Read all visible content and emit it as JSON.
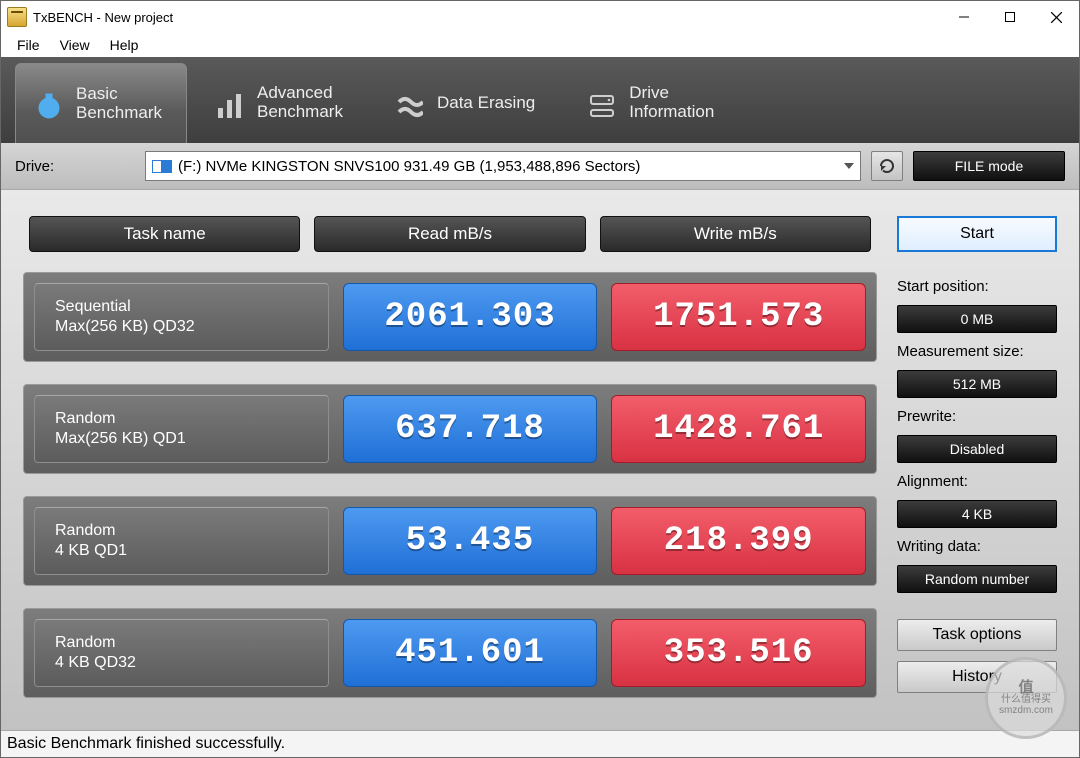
{
  "window": {
    "title": "TxBENCH - New project"
  },
  "menu": {
    "file": "File",
    "view": "View",
    "help": "Help"
  },
  "tabs": {
    "basic": "Basic\nBenchmark",
    "advanced": "Advanced\nBenchmark",
    "erasing": "Data Erasing",
    "driveinfo": "Drive\nInformation"
  },
  "drive": {
    "label": "Drive:",
    "selected": "(F:) NVMe KINGSTON SNVS100  931.49 GB (1,953,488,896 Sectors)",
    "mode_button": "FILE mode"
  },
  "headers": {
    "task": "Task name",
    "read": "Read mB/s",
    "write": "Write mB/s"
  },
  "rows": [
    {
      "name": "Sequential",
      "sub": "Max(256 KB) QD32",
      "read": "2061.303",
      "write": "1751.573"
    },
    {
      "name": "Random",
      "sub": "Max(256 KB) QD1",
      "read": "637.718",
      "write": "1428.761"
    },
    {
      "name": "Random",
      "sub": "4 KB QD1",
      "read": "53.435",
      "write": "218.399"
    },
    {
      "name": "Random",
      "sub": "4 KB QD32",
      "read": "451.601",
      "write": "353.516"
    }
  ],
  "sidebar": {
    "start": "Start",
    "start_pos_label": "Start position:",
    "start_pos": "0 MB",
    "meas_size_label": "Measurement size:",
    "meas_size": "512 MB",
    "prewrite_label": "Prewrite:",
    "prewrite": "Disabled",
    "alignment_label": "Alignment:",
    "alignment": "4 KB",
    "writing_label": "Writing data:",
    "writing": "Random number",
    "task_options": "Task options",
    "history": "History"
  },
  "status": "Basic Benchmark finished successfully.",
  "watermark": {
    "brand": "值",
    "line1": "什么值得买",
    "line2": "smzdm.com"
  }
}
